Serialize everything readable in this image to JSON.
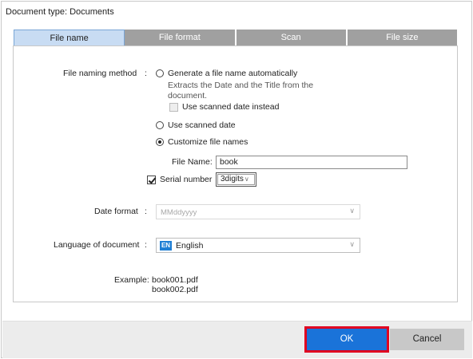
{
  "dialog": {
    "document_type_label": "Document type: Documents"
  },
  "tabs": [
    {
      "label": "File name",
      "active": true
    },
    {
      "label": "File format",
      "active": false
    },
    {
      "label": "Scan",
      "active": false
    },
    {
      "label": "File size",
      "active": false
    }
  ],
  "file_naming": {
    "label": "File naming method",
    "separator": ":",
    "options": [
      {
        "label": "Generate a file name automatically",
        "checked": false
      },
      {
        "label": "Use scanned date",
        "checked": false
      },
      {
        "label": "Customize file names",
        "checked": true
      }
    ],
    "auto_description_line1": "Extracts the Date and the Title from the",
    "auto_description_line2": "document.",
    "use_scanned_date_instead": {
      "label": "Use scanned date instead",
      "checked": false,
      "enabled": false
    },
    "file_name": {
      "label": "File Name:",
      "value": "book"
    },
    "serial_number": {
      "label": "Serial number",
      "checked": true,
      "selected": "3digits"
    }
  },
  "date_format": {
    "label": "Date format",
    "separator": ":",
    "value": "MMddyyyy",
    "enabled": false
  },
  "language": {
    "label": "Language of document",
    "separator": ":",
    "badge": "EN",
    "value": "English"
  },
  "example": {
    "label": "Example:",
    "line1": "book001.pdf",
    "line2": "book002.pdf"
  },
  "footer": {
    "ok_label": "OK",
    "cancel_label": "Cancel",
    "ok_highlight_color": "#e00020",
    "ok_color": "#1a73d9"
  },
  "icons": {
    "chevron": "chevron-down-icon",
    "check": "check-icon"
  }
}
